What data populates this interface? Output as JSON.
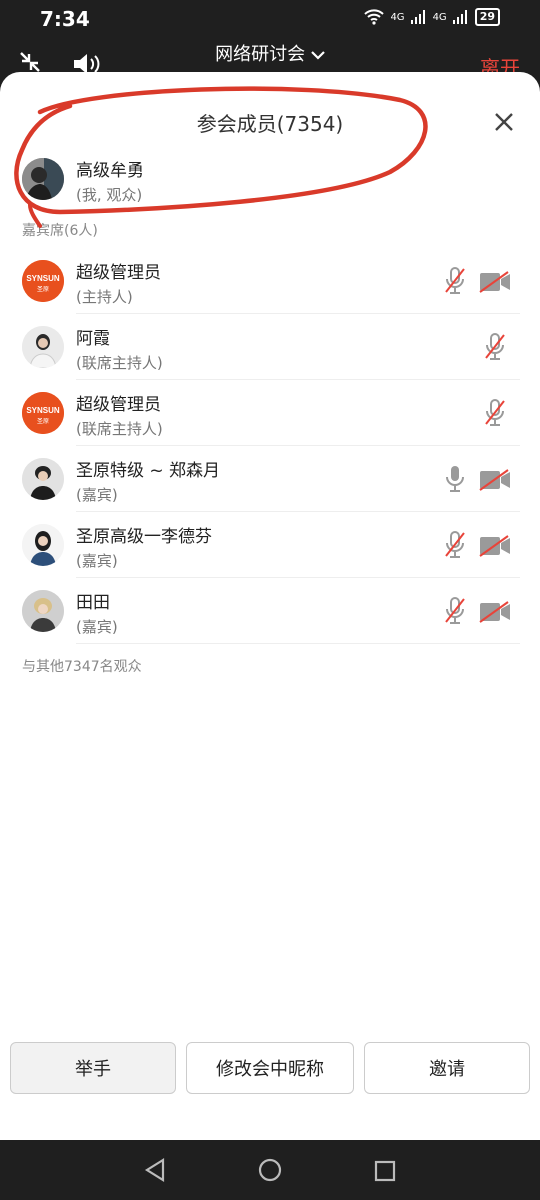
{
  "status": {
    "time": "7:34",
    "net1": "4G",
    "net2": "4G",
    "battery": "29"
  },
  "top": {
    "title": "网络研讨会",
    "leave": "离开"
  },
  "panel": {
    "title": "参会成员(7354)"
  },
  "me": {
    "name": "高级牟勇",
    "role": "(我, 观众)"
  },
  "guests": {
    "label": "嘉宾席(6人)",
    "items": [
      {
        "name": "超级管理员",
        "role": "(主持人)",
        "mic": "muted",
        "cam": "off"
      },
      {
        "name": "阿霞",
        "role": "(联席主持人)",
        "mic": "muted",
        "cam": "none"
      },
      {
        "name": "超级管理员",
        "role": "(联席主持人)",
        "mic": "muted",
        "cam": "none"
      },
      {
        "name": "圣原特级 ~ 郑森月",
        "role": "(嘉宾)",
        "mic": "on",
        "cam": "off"
      },
      {
        "name": "圣原高级一李德芬",
        "role": "(嘉宾)",
        "mic": "muted",
        "cam": "off"
      },
      {
        "name": "田田",
        "role": "(嘉宾)",
        "mic": "muted",
        "cam": "off"
      }
    ],
    "logo_text": "SYNSUN",
    "logo_sub": "圣原"
  },
  "others": {
    "label": "与其他7347名观众"
  },
  "buttons": {
    "raise": "举手",
    "rename": "修改会中昵称",
    "invite": "邀请"
  },
  "colors": {
    "accent_red": "#e8443a",
    "logo_orange": "#e8501e",
    "muted_gray": "#9a9a9a"
  }
}
